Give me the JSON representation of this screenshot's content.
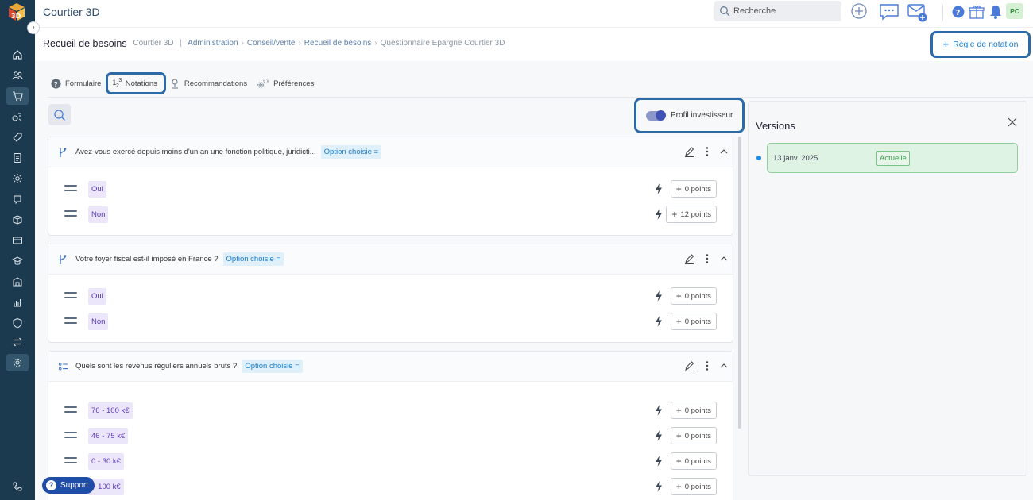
{
  "app": {
    "title": "Courtier 3D"
  },
  "topbar": {
    "search_placeholder": "Recherche",
    "avatar_initials": "PC"
  },
  "breadcrumb": {
    "title": "Recueil de besoins",
    "items": [
      "Courtier 3D",
      "Administration",
      "Conseil/vente",
      "Recueil de besoins",
      "Questionnaire Epargne Courtier 3D"
    ]
  },
  "actions": {
    "rule_button": "Règle de notation"
  },
  "tabs": [
    {
      "label": "Formulaire",
      "icon": "question-circle-icon"
    },
    {
      "label": "Notations",
      "icon": "numbers-icon"
    },
    {
      "label": "Recommandations",
      "icon": "user-pin-icon"
    },
    {
      "label": "Préférences",
      "icon": "gears-icon"
    }
  ],
  "active_tab": "Notations",
  "profile_toggle": {
    "label": "Profil investisseur",
    "checked": true
  },
  "questions": [
    {
      "title": "Avez-vous exercé depuis moins d'un an une fonction politique, juridicti...",
      "badge": "Option choisie =",
      "icon": "branch-icon",
      "options": [
        {
          "label": "Oui",
          "points": "0 points"
        },
        {
          "label": "Non",
          "points": "12 points"
        }
      ]
    },
    {
      "title": "Votre foyer fiscal est-il imposé en France ?",
      "badge": "Option choisie =",
      "icon": "branch-icon",
      "options": [
        {
          "label": "Oui",
          "points": "0 points"
        },
        {
          "label": "Non",
          "points": "0 points"
        }
      ]
    },
    {
      "title": "Quels sont les revenus réguliers annuels bruts ?",
      "badge": "Option choisie =",
      "icon": "list-icon",
      "options": [
        {
          "label": "76 - 100 k€",
          "points": "0 points"
        },
        {
          "label": "46 - 75 k€",
          "points": "0 points"
        },
        {
          "label": "0 - 30 k€",
          "points": "0 points"
        },
        {
          "label": "> 100 k€",
          "points": "0 points"
        }
      ]
    }
  ],
  "versions": {
    "title": "Versions",
    "items": [
      {
        "date": "13 janv. 2025",
        "badge": "Actuelle"
      }
    ]
  },
  "support": {
    "label": "Support"
  },
  "colors": {
    "sidebar": "#1b3a4f",
    "accent": "#2d6aa8",
    "success": "#8ed09b",
    "option_bg": "#ece6fb"
  }
}
